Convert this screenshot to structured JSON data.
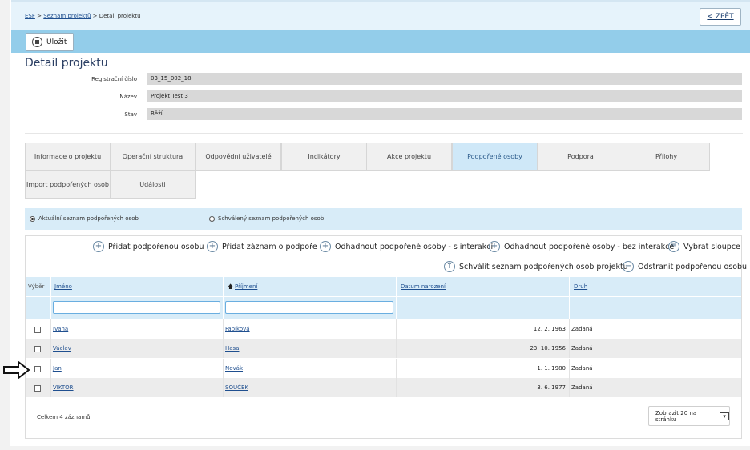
{
  "breadcrumb": {
    "root": "ESF",
    "parent": "Seznam projektů",
    "current": "Detail projektu",
    "sep": ">"
  },
  "back_label": "< ZPĚT",
  "save_label": "Uložit",
  "page_title": "Detail projektu",
  "fields": [
    {
      "label": "Registrační číslo",
      "value": "03_15_002_18"
    },
    {
      "label": "Název",
      "value": "Projekt Test 3"
    },
    {
      "label": "Stav",
      "value": "Běží"
    }
  ],
  "tabs": [
    "Informace o projektu",
    "Operační struktura",
    "Odpovědní uživatelé",
    "Indikátory",
    "Akce projektu",
    "Podpořené osoby",
    "Podpora",
    "Přílohy",
    "Import podpořených osob",
    "Události"
  ],
  "active_tab": "Podpořené osoby",
  "radios": {
    "current": "Aktuální seznam podpořených osob",
    "approved": "Schválený seznam podpořených osob",
    "selected": "current"
  },
  "actions": {
    "add_person": "Přidat podpořenou osobu",
    "add_support": "Přidat záznam o podpoře",
    "estimate_with": "Odhadnout podpořené osoby - s interakcí",
    "estimate_without": "Odhadnout podpořené osoby - bez interakce",
    "choose_columns": "Vybrat sloupce",
    "approve_list": "Schválit seznam podpořených osob projektu",
    "remove_person": "Odstranit podpořenou osobu"
  },
  "table": {
    "headers": {
      "select": "Výběr",
      "first_name": "Jméno",
      "last_name": "Příjmení",
      "birth": "Datum narození",
      "type": "Druh"
    },
    "sort_indicator": "🡅",
    "rows": [
      {
        "first_name": "Ivana",
        "last_name": "Fabíková",
        "birth": "12. 2. 1963",
        "type": "Zadaná"
      },
      {
        "first_name": "Václav",
        "last_name": "Hasa",
        "birth": "23. 10. 1956",
        "type": "Zadaná"
      },
      {
        "first_name": "Jan",
        "last_name": "Novák",
        "birth": "1. 1. 1980",
        "type": "Zadaná"
      },
      {
        "first_name": "VIKTOR",
        "last_name": "SOUČEK",
        "birth": "3. 6. 1977",
        "type": "Zadaná"
      }
    ]
  },
  "total_label": "Celkem 4 záznamů",
  "page_size_label": "Zobrazit 20 na stránku"
}
